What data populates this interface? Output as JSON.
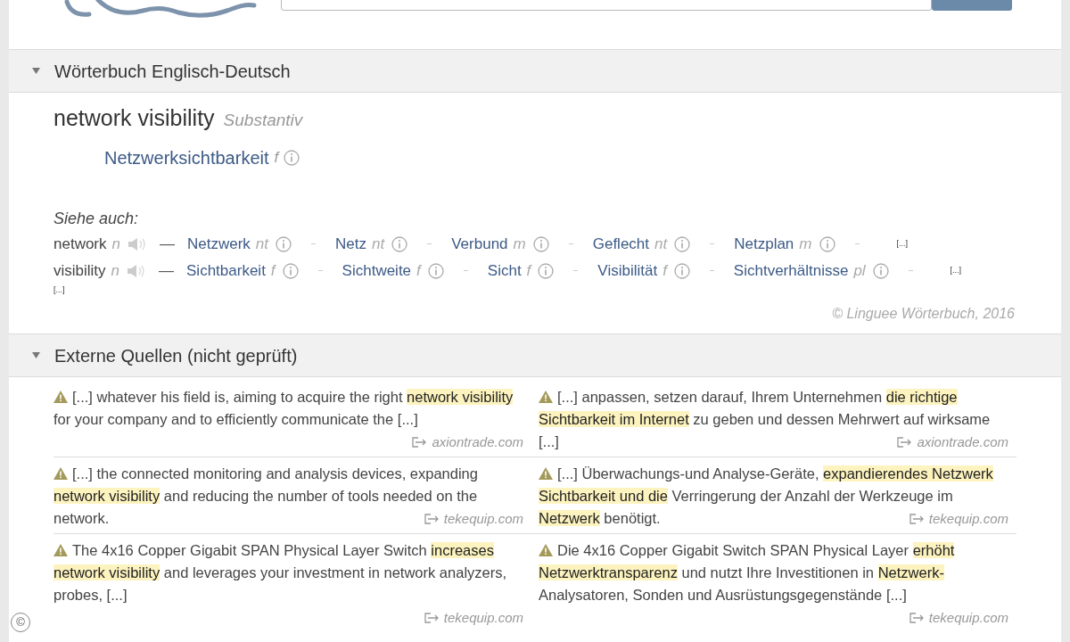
{
  "dictionary": {
    "title": "Wörterbuch Englisch-Deutsch",
    "expanded": true,
    "entry": {
      "headword": "network visibility",
      "pos": "Substantiv",
      "translations": [
        {
          "term": "Netzwerksichtbarkeit",
          "gender": "f"
        }
      ]
    },
    "see_also": {
      "label": "Siehe auch:",
      "rows": [
        {
          "word": "network",
          "pos": "n",
          "dash": "—",
          "translations": [
            {
              "term": "Netzwerk",
              "gender": "nt"
            },
            {
              "term": "Netz",
              "gender": "nt"
            },
            {
              "term": "Verbund",
              "gender": "m"
            },
            {
              "term": "Geflecht",
              "gender": "nt"
            },
            {
              "term": "Netzplan",
              "gender": "m"
            }
          ],
          "more": "[...]"
        },
        {
          "word": "visibility",
          "pos": "n",
          "dash": "—",
          "translations": [
            {
              "term": "Sichtbarkeit",
              "gender": "f"
            },
            {
              "term": "Sichtweite",
              "gender": "f"
            },
            {
              "term": "Sicht",
              "gender": "f"
            },
            {
              "term": "Visibilität",
              "gender": "f"
            },
            {
              "term": "Sichtverhältnisse",
              "gender": "pl"
            }
          ],
          "more": "[...]"
        }
      ],
      "overflow": "[...]"
    },
    "copyright": "© Linguee Wörterbuch, 2016"
  },
  "external": {
    "title": "Externe Quellen (nicht geprüft)",
    "expanded": true,
    "examples": [
      {
        "english": [
          {
            "text": "[...] whatever his field is, aiming to acquire the right ",
            "highlight": false
          },
          {
            "text": "network visibility",
            "highlight": true
          },
          {
            "text": " for your company and to efficiently communicate the [...]",
            "highlight": false
          }
        ],
        "english_source": "axiontrade.com",
        "german": [
          {
            "text": "[...] anpassen, setzen darauf, Ihrem Unternehmen ",
            "highlight": false
          },
          {
            "text": "die richtige Sichtbarkeit im Internet",
            "highlight": true
          },
          {
            "text": " zu geben und dessen Mehrwert auf wirksame [...]",
            "highlight": false
          }
        ],
        "german_source": "axiontrade.com"
      },
      {
        "english": [
          {
            "text": "[...] the connected monitoring and analysis devices, expanding ",
            "highlight": false
          },
          {
            "text": "network visibility",
            "highlight": true
          },
          {
            "text": " and reducing the number of tools needed on the network.",
            "highlight": false
          }
        ],
        "english_source": "tekequip.com",
        "german": [
          {
            "text": "[...] Überwachungs-und Analyse-Geräte, ",
            "highlight": false
          },
          {
            "text": "expandierendes Netzwerk Sichtbarkeit und die",
            "highlight": true
          },
          {
            "text": " Verringerung der Anzahl der Werkzeuge im ",
            "highlight": false
          },
          {
            "text": "Netzwerk",
            "highlight": true
          },
          {
            "text": " benötigt.",
            "highlight": false
          }
        ],
        "german_source": "tekequip.com"
      },
      {
        "english": [
          {
            "text": "The 4x16 Copper Gigabit SPAN Physical Layer Switch ",
            "highlight": false
          },
          {
            "text": "increases network visibility",
            "highlight": true
          },
          {
            "text": " and leverages your investment in network analyzers, probes, [...]",
            "highlight": false
          }
        ],
        "english_source": "tekequip.com",
        "german": [
          {
            "text": "Die 4x16 Copper Gigabit Switch SPAN Physical Layer ",
            "highlight": false
          },
          {
            "text": "erhöht Netzwerktransparenz",
            "highlight": true
          },
          {
            "text": " und nutzt Ihre Investitionen in ",
            "highlight": false
          },
          {
            "text": "Netzwerk-",
            "highlight": true
          },
          {
            "text": "Analysatoren, Sonden und Ausrüstungsgegenstände [...]",
            "highlight": false
          }
        ],
        "german_source": "tekequip.com"
      }
    ]
  },
  "corner_badge": "©"
}
